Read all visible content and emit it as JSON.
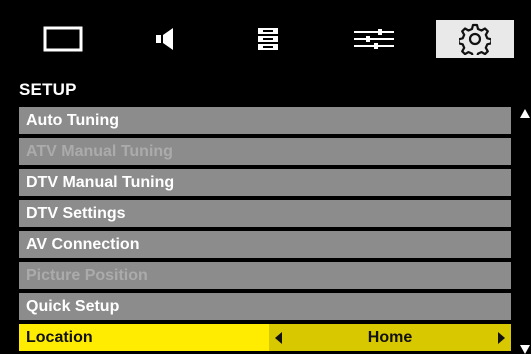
{
  "tabs": [
    {
      "name": "picture",
      "icon": "picture-icon",
      "active": false
    },
    {
      "name": "sound",
      "icon": "speaker-icon",
      "active": false
    },
    {
      "name": "channel",
      "icon": "channel-list-icon",
      "active": false
    },
    {
      "name": "features",
      "icon": "sliders-icon",
      "active": false
    },
    {
      "name": "setup",
      "icon": "gear-icon",
      "active": true
    }
  ],
  "section_title": "SETUP",
  "menu": {
    "items": [
      {
        "label": "Auto Tuning",
        "state": "enabled"
      },
      {
        "label": "ATV Manual Tuning",
        "state": "disabled"
      },
      {
        "label": "DTV Manual Tuning",
        "state": "enabled"
      },
      {
        "label": "DTV Settings",
        "state": "enabled"
      },
      {
        "label": "AV Connection",
        "state": "enabled"
      },
      {
        "label": "Picture Position",
        "state": "disabled"
      },
      {
        "label": "Quick Setup",
        "state": "enabled"
      }
    ],
    "selected": {
      "label": "Location",
      "value": "Home"
    }
  },
  "colors": {
    "background": "#000000",
    "row": "#8c8c8c",
    "row_text": "#ffffff",
    "row_disabled_text": "#ababab",
    "highlight": "#ffec00",
    "highlight_value": "#d8c800",
    "active_tab": "#e9e9e9"
  },
  "scrollbar": {
    "up_icon": "scroll-up-arrow-icon",
    "down_icon": "scroll-down-arrow-icon"
  }
}
